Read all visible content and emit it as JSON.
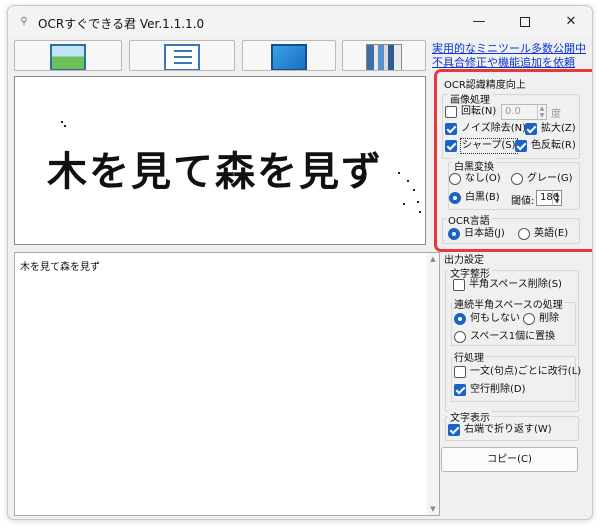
{
  "window": {
    "title": "OCRすぐできる君 Ver.1.1.1.0",
    "minimize": "—",
    "close": "✕"
  },
  "toolbar": {
    "icons": [
      "image-open-icon",
      "document-list-icon",
      "monitor-capture-icon",
      "books-icon"
    ]
  },
  "links": {
    "link1": "実用的なミニツール多数公開中",
    "link2": "不具合修正や機能追加を依頼"
  },
  "image_preview": {
    "text": "木を見て森を見ず"
  },
  "result": {
    "text": "木を見て森を見ず"
  },
  "ocr_precision": {
    "title": "OCR認識精度向上",
    "image_processing": {
      "title": "画像処理",
      "rotate": "回転(N)",
      "rotate_checked": false,
      "rotate_value": "0.0",
      "rotate_unit": "度",
      "noise": "ノイズ除去(N)",
      "noise_checked": true,
      "enlarge": "拡大(Z)",
      "enlarge_checked": true,
      "sharp": "シャープ(S)",
      "sharp_checked": true,
      "invert": "色反転(R)",
      "invert_checked": true
    },
    "bw": {
      "title": "白黒変換",
      "none": "なし(O)",
      "gray": "グレー(G)",
      "mono": "白黒(B)",
      "selected": "mono",
      "threshold_label": "閾値:",
      "threshold_value": "180"
    },
    "language": {
      "title": "OCR言語",
      "japanese": "日本語(J)",
      "english": "英語(E)",
      "selected": "japanese"
    }
  },
  "output": {
    "title": "出力設定",
    "char_shape": {
      "title": "文字整形",
      "remove_halfspace": "半角スペース削除(S)",
      "remove_halfspace_checked": false
    },
    "consecutive": {
      "title": "連続半角スペースの処理",
      "nothing": "何もしない",
      "delete": "削除",
      "replace": "スペース1個に置換",
      "selected": "nothing"
    },
    "line": {
      "title": "行処理",
      "break_each": "一文(句点)ごとに改行(L)",
      "break_each_checked": false,
      "remove_empty": "空行削除(D)",
      "remove_empty_checked": true
    },
    "display": {
      "title": "文字表示",
      "wrap": "右端で折り返す(W)",
      "wrap_checked": true
    }
  },
  "copy_button": "コピー(C)",
  "colors": {
    "highlight": "#e53a3a",
    "accent": "#1b63c6",
    "link": "#0b36d6"
  }
}
